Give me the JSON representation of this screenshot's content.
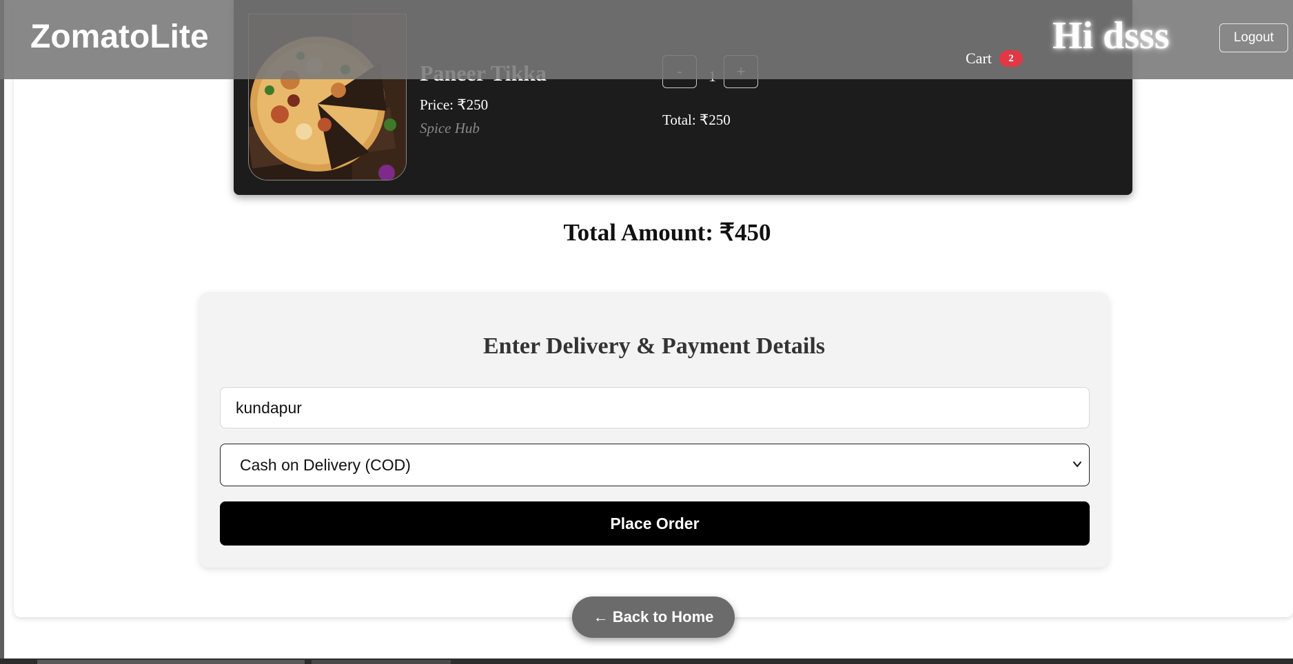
{
  "header": {
    "brand": "ZomatoLite",
    "cart_label": "Cart",
    "cart_count": "2",
    "greeting": "Hi dsss",
    "logout_label": "Logout"
  },
  "cart": {
    "items": [
      {
        "name": "Paneer Tikka",
        "price": "Price: ₹250",
        "restaurant": "Spice Hub",
        "quantity": "1",
        "minus_label": "-",
        "plus_label": "+",
        "total": "Total: ₹250",
        "image_icon": "pizza-photo"
      }
    ],
    "total_amount": "Total Amount: ₹450"
  },
  "checkout": {
    "title": "Enter Delivery & Payment Details",
    "address_value": "kundapur",
    "payment_method": "Cash on Delivery (COD)",
    "place_order_label": "Place Order"
  },
  "navigation": {
    "back_home_label": "← Back to Home"
  },
  "colors": {
    "header_bg": "#787878",
    "cart_item_bg": "#1c1c1c",
    "badge": "#e23744",
    "primary_button": "#000000",
    "back_button": "#6b6b6b"
  }
}
